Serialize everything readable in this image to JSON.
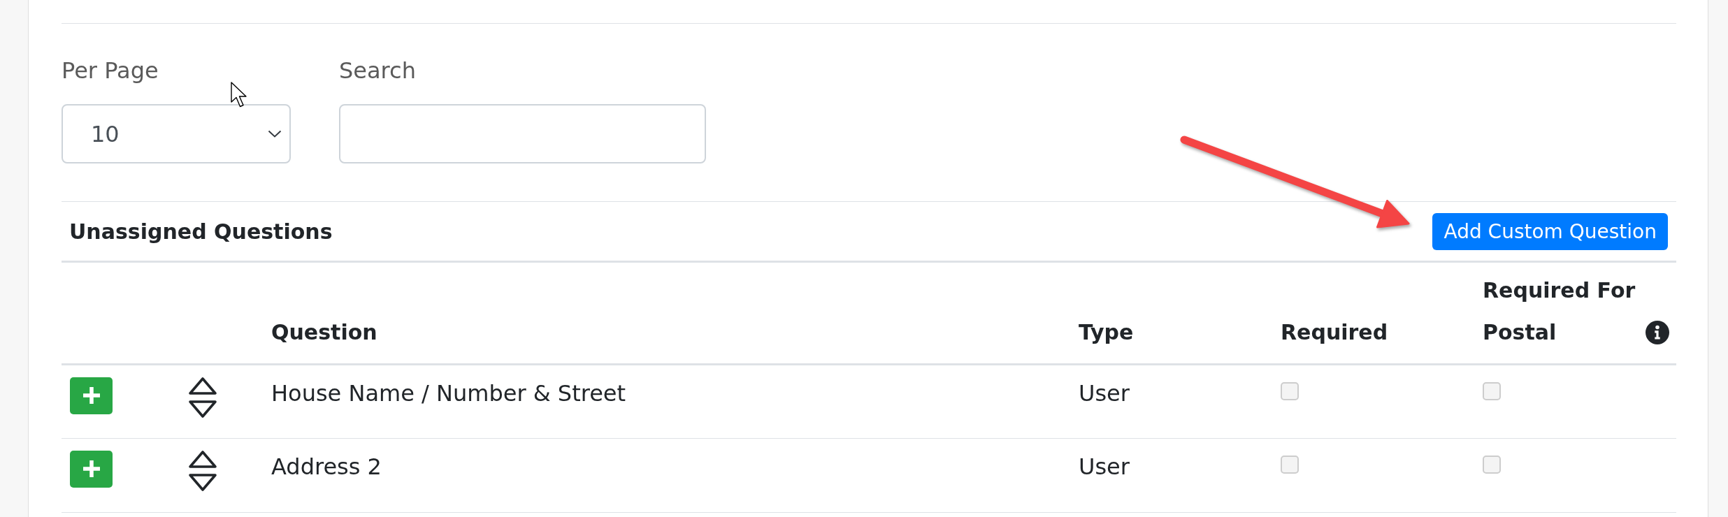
{
  "filters": {
    "per_page": {
      "label": "Per Page",
      "value": "10"
    },
    "search": {
      "label": "Search"
    }
  },
  "section": {
    "title": "Unassigned Questions",
    "button": "Add Custom Question"
  },
  "table": {
    "columns": [
      {
        "label": "Question",
        "info": false
      },
      {
        "label": "Type",
        "info": false
      },
      {
        "label": "Required",
        "info": false
      },
      {
        "label": "Required For Postal",
        "info": true
      }
    ],
    "rows": [
      {
        "question": "House Name / Number & Street",
        "type": "User",
        "required": false,
        "required_for_postal": false
      },
      {
        "question": "Address 2",
        "type": "User",
        "required": false,
        "required_for_postal": false
      }
    ]
  }
}
